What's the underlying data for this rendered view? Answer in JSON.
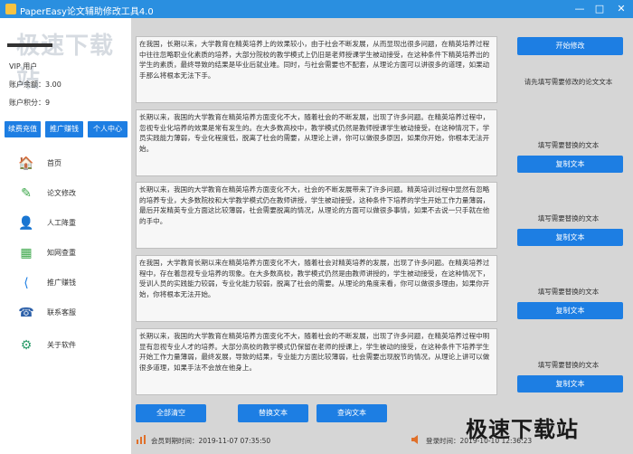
{
  "titlebar": {
    "title": "PaperEasy论文辅助修改工具4.0",
    "min": "—",
    "max": "□",
    "close": "✕"
  },
  "watermark": {
    "top": "极速下载站",
    "bottom": "极速下载站"
  },
  "account": {
    "vip": "VIP 用户",
    "balance": "账户余额：3.00",
    "points": "账户积分：9"
  },
  "side_buttons": {
    "recharge": "续费充值",
    "promo": "推广赚钱",
    "personal": "个人中心"
  },
  "nav": [
    {
      "label": "首页",
      "icon": "home-icon",
      "glyph": "🏠"
    },
    {
      "label": "论文修改",
      "icon": "pencil-icon",
      "glyph": "✎"
    },
    {
      "label": "人工降重",
      "icon": "person-icon",
      "glyph": "👤"
    },
    {
      "label": "知网查重",
      "icon": "table-icon",
      "glyph": "▦"
    },
    {
      "label": "推广赚钱",
      "icon": "share-icon",
      "glyph": "⟨"
    },
    {
      "label": "联系客服",
      "icon": "headset-icon",
      "glyph": "☎"
    },
    {
      "label": "关于软件",
      "icon": "gear-icon",
      "glyph": "⚙"
    }
  ],
  "text_boxes": [
    {
      "text": "在我国，长期以来，大学教育在精英培养上的效果较小，由于社会不断发展，从而显现出很多问题，在精英培养过程中往往忽略职业化素质的培养，大部分院校的教学模式上仍旧是老师授课学生被动接受，在这种条件下精英培养出的学生的素质，最终导致的结果是毕业后就业难。同时，与社会需要也不配套，从理论方面可以讲很多的道理，如果动手那么将根本无法下手。"
    },
    {
      "text": "长期以来，我国的大学教育在精英培养方面变化不大，随着社会的不断发展，出现了许多问题。在精英培养过程中，忽视专业化培养的效果是常有发生的。在大多数高校中，教学模式仍然是教师授课学生被动接受，在这种情况下，学员实践能力薄弱，专业化程度低，脱离了社会的需要，从理论上讲，你可以做很多原因，如果你开始，你根本无法开始。"
    },
    {
      "text": "长期以来，我国的大学教育在精英培养方面变化不大，社会的不断发展带来了许多问题。精英培训过程中显然有忽略的培养专业，大多数院校和大学教学模式仍在教师讲授，学生被动接受，这种条件下培养的学生开始工作力量薄弱，最后开发精英专业方面这比较薄弱，社会需要脱离的情况，从理论的方面可以做很多事情，如果不去说一只手就在他的手中。"
    },
    {
      "text": "在我国，大学教育长期以来在精英培养方面变化不大，随着社会对精英培养的发展，出现了许多问题。在精英培养过程中，存在着忽视专业培养的现象。在大多数高校，教学模式仍然是由教师讲授的，学生被动接受，在这种情况下，受训人员的实践能力较弱，专业化能力较弱，脱离了社会的需要。从理论的角度来看，你可以做很多理由，如果你开始，你将根本无法开始。"
    },
    {
      "text": "长期以来，我国的大学教育在精英培养方面变化不大，随着社会的不断发展，出现了许多问题，在精英培养过程中明显有忽视专业人才的培养。大部分高校的教学模式仍保留在老师的授课上，学生被动的接受，在这种条件下培养学生开始工作力量薄弱，最终发展，导致的结果，专业能力方面比较薄弱，社会需要出现脱节的情况，从理论上讲可以做很多道理，如果手法不会放在他身上。"
    }
  ],
  "right_panel": {
    "start_button": "开始修改",
    "hint": "请先填写需要修改的论文文本",
    "groups": [
      {
        "label": "填写需要替换的文本",
        "button": "复制文本"
      },
      {
        "label": "填写需要替换的文本",
        "button": "复制文本"
      },
      {
        "label": "填写需要替换的文本",
        "button": "复制文本"
      },
      {
        "label": "填写需要替换的文本",
        "button": "复制文本"
      }
    ]
  },
  "bottom_buttons": {
    "clear_all": "全部清空",
    "replace": "替换文本",
    "query": "查询文本"
  },
  "status": {
    "member_expiry": "会员到期时间：2019-11-07 07:35:50",
    "login_time": "登录时间：2019-10-10 12:36:23"
  },
  "colors": {
    "accent": "#1d7ee3",
    "titlebar": "#2a8fe0",
    "panel_bg": "#d6d6d6"
  }
}
